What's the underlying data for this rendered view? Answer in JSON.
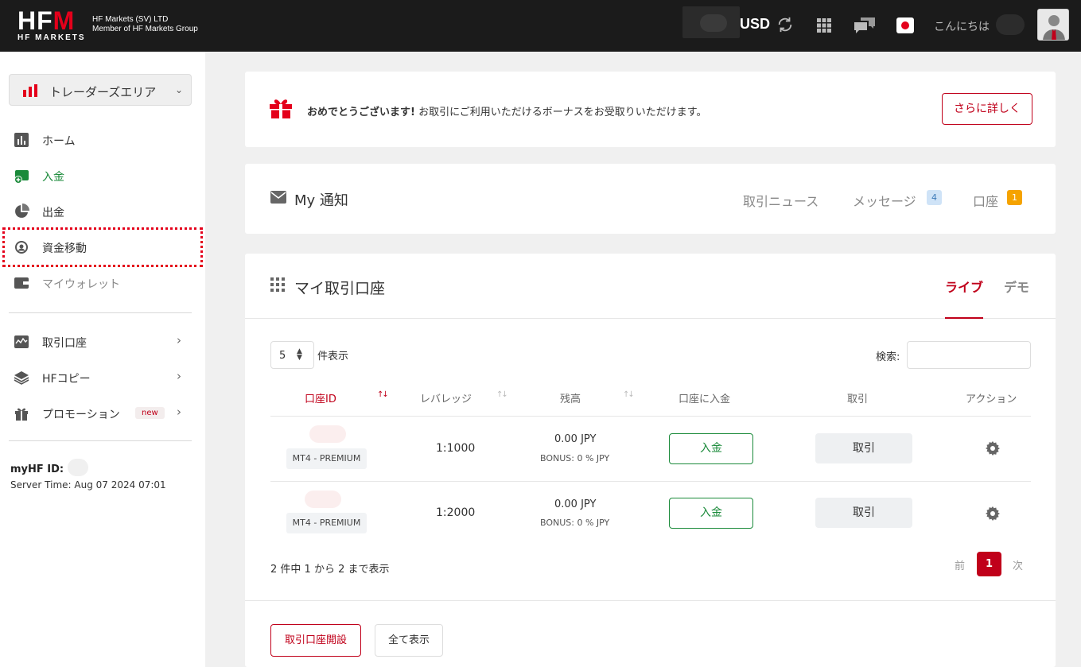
{
  "header": {
    "logo_text": "HFM",
    "logo_sub": "HF MARKETS",
    "company_line1": "HF Markets (SV) LTD",
    "company_line2": "Member of HF Markets Group",
    "currency": "USD",
    "greeting": "こんにちは"
  },
  "sidebar": {
    "area_label": "トレーダーズエリア",
    "items": [
      {
        "label": "ホーム",
        "icon": "bar-chart-icon"
      },
      {
        "label": "入金",
        "icon": "wallet-add-icon"
      },
      {
        "label": "出金",
        "icon": "pie-icon"
      },
      {
        "label": "資金移動",
        "icon": "transfer-icon"
      },
      {
        "label": "マイウォレット",
        "icon": "wallet-icon"
      },
      {
        "label": "取引口座",
        "icon": "chart-line-icon"
      },
      {
        "label": "HFコピー",
        "icon": "layers-icon"
      },
      {
        "label": "プロモーション",
        "icon": "gift-icon"
      }
    ],
    "new_badge": "new",
    "myhf_label": "myHF ID:",
    "server_time": "Server Time: Aug 07 2024 07:01"
  },
  "bonus": {
    "bold_text": "おめでとうございます!",
    "text": " お取引にご利用いただけるボーナスをお受取りいただけます。",
    "button": "さらに詳しく"
  },
  "notifications": {
    "title": "My 通知",
    "tabs": [
      {
        "label": "取引ニュース"
      },
      {
        "label": "メッセージ",
        "count": "4"
      },
      {
        "label": "口座",
        "count": "1"
      }
    ]
  },
  "accounts": {
    "title": "マイ取引口座",
    "tab_live": "ライブ",
    "tab_demo": "デモ",
    "page_length": "5",
    "page_length_label": "件表示",
    "search_label": "検索:",
    "columns": [
      "口座ID",
      "レバレッジ",
      "残高",
      "口座に入金",
      "取引",
      "アクション"
    ],
    "rows": [
      {
        "type": "MT4 - PREMIUM",
        "leverage": "1:1000",
        "balance": "0.00 JPY",
        "bonus": "BONUS: 0 % JPY",
        "deposit": "入金",
        "trade": "取引"
      },
      {
        "type": "MT4 - PREMIUM",
        "leverage": "1:2000",
        "balance": "0.00 JPY",
        "bonus": "BONUS: 0 % JPY",
        "deposit": "入金",
        "trade": "取引"
      }
    ],
    "info": "2 件中 1 から 2 まで表示",
    "prev": "前",
    "page": "1",
    "next": "次",
    "open_button": "取引口座開設",
    "all_button": "全て表示"
  },
  "colors": {
    "brand_red": "#c0001a",
    "green": "#1a8a3a",
    "topbar": "#1b1b1b"
  }
}
